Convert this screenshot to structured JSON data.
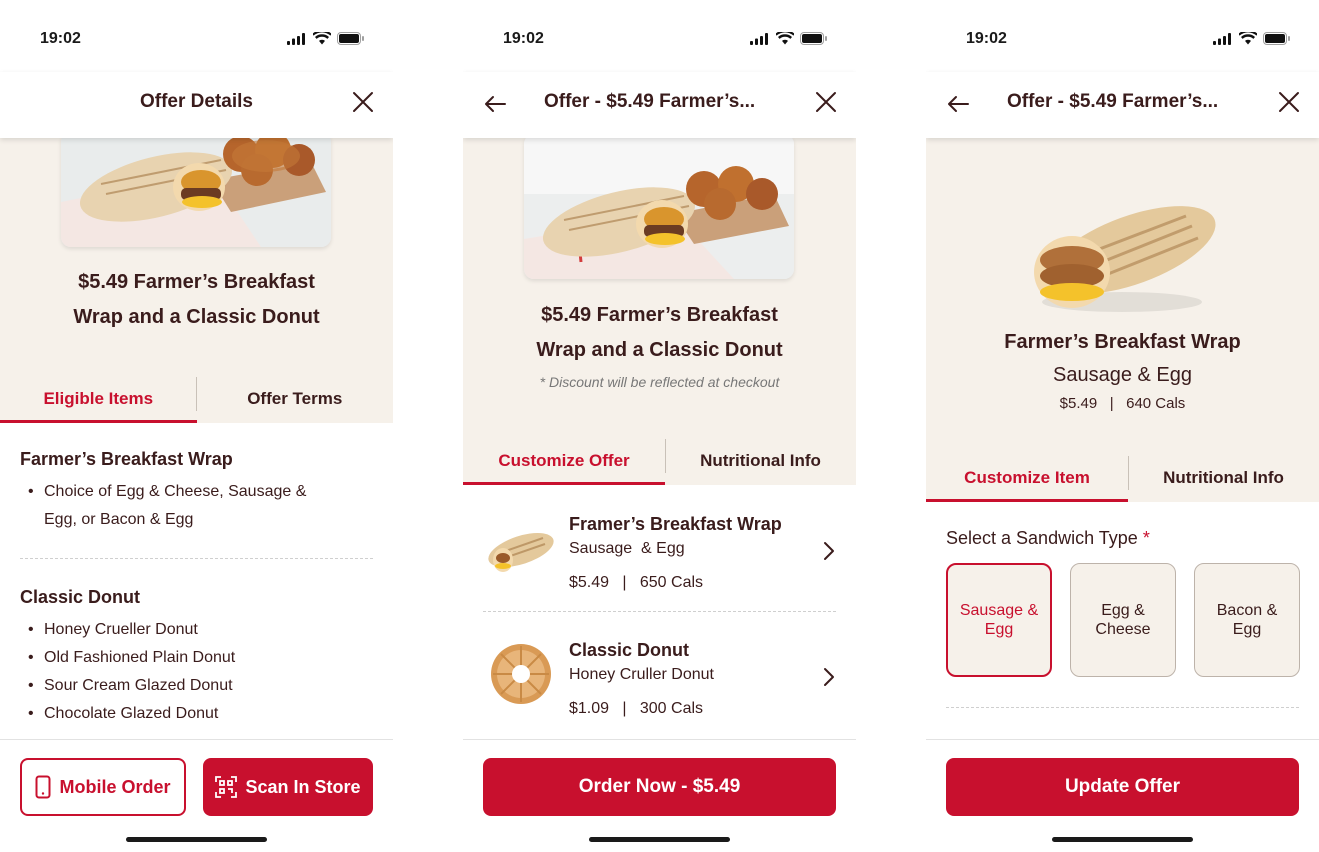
{
  "status_bar": {
    "time": "19:02"
  },
  "colors": {
    "brand_red": "#c8102e",
    "text_brown": "#3a1c1c",
    "hero_bg": "#f6f1ea"
  },
  "screen1": {
    "header_title": "Offer Details",
    "hero_title_line1": "$5.49 Farmer’s Breakfast",
    "hero_title_line2": "Wrap and a Classic Donut",
    "tabs": [
      {
        "label": "Eligible Items",
        "active": true
      },
      {
        "label": "Offer Terms",
        "active": false
      }
    ],
    "sections": [
      {
        "title": "Farmer’s Breakfast Wrap",
        "items": [
          "Choice of Egg & Cheese, Sausage &",
          "Egg, or Bacon & Egg"
        ]
      },
      {
        "title": "Classic Donut",
        "items": [
          "Honey Crueller Donut",
          "Old Fashioned Plain Donut",
          "Sour Cream Glazed Donut",
          "Chocolate Glazed Donut"
        ]
      }
    ],
    "buttons": {
      "mobile_order": "Mobile Order",
      "scan_in_store": "Scan In Store"
    },
    "icons": {
      "mobile": "phone-icon",
      "scan": "scan-qr-icon",
      "close": "close-icon"
    }
  },
  "screen2": {
    "header_title": "Offer - $5.49 Farmer’s...",
    "hero_title_line1": "$5.49 Farmer’s Breakfast",
    "hero_title_line2": "Wrap and a Classic Donut",
    "note": "* Discount will be reflected at checkout",
    "tabs": [
      {
        "label": "Customize Offer",
        "active": true
      },
      {
        "label": "Nutritional Info",
        "active": false
      }
    ],
    "products": [
      {
        "name": "Framer’s Breakfast Wrap",
        "variant": "Sausage  & Egg",
        "price": "$5.49",
        "cals": "650 Cals",
        "meta": "$5.49   |   650 Cals"
      },
      {
        "name": "Classic Donut",
        "variant": "Honey Cruller Donut",
        "price": "$1.09",
        "cals": "300 Cals",
        "meta": "$1.09   |   300 Cals"
      }
    ],
    "order_button": "Order Now - $5.49"
  },
  "screen3": {
    "header_title": "Offer - $5.49 Farmer’s...",
    "product_name": "Farmer’s Breakfast Wrap",
    "variant": "Sausage & Egg",
    "meta": "$5.49   |   640 Cals",
    "tabs": [
      {
        "label": "Customize Item",
        "active": true
      },
      {
        "label": "Nutritional Info",
        "active": false
      }
    ],
    "select_label": "Select a Sandwich Type",
    "required_mark": "*",
    "options": [
      {
        "label": "Sausage & Egg",
        "selected": true
      },
      {
        "label": "Egg & Cheese",
        "selected": false
      },
      {
        "label": "Bacon & Egg",
        "selected": false
      }
    ],
    "update_button": "Update Offer"
  }
}
